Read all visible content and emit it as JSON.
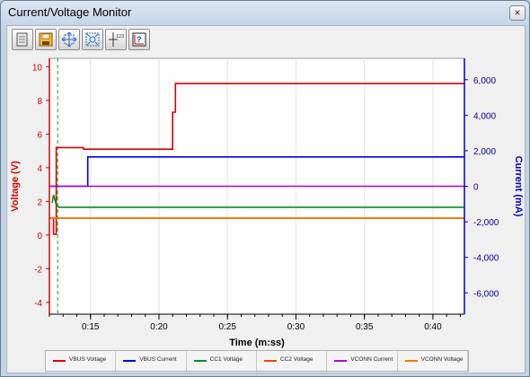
{
  "window": {
    "title": "Current/Voltage Monitor",
    "close_glyph": "×"
  },
  "toolbar": {
    "buttons": [
      {
        "name": "open-icon"
      },
      {
        "name": "save-icon"
      },
      {
        "name": "zoom-fit-icon"
      },
      {
        "name": "zoom-in-icon"
      },
      {
        "name": "cursor-measure-icon",
        "label": "123"
      },
      {
        "name": "chart-settings-icon"
      }
    ]
  },
  "chart_data": {
    "type": "line",
    "xlabel": "Time (m:ss)",
    "ylabel_left": "Voltage (V)",
    "ylabel_right": "Current (mA)",
    "x_ticks": [
      "0:15",
      "0:20",
      "0:25",
      "0:30",
      "0:35",
      "0:40"
    ],
    "x_tick_values": [
      15,
      20,
      25,
      30,
      35,
      40
    ],
    "xlim": [
      12,
      42.3
    ],
    "ylim_left": [
      -4.7,
      10.5
    ],
    "ylim_right": [
      -7200,
      7200
    ],
    "y_left_ticks": [
      "-4",
      "-2",
      "0",
      "2",
      "4",
      "6",
      "8",
      "10"
    ],
    "y_right_ticks": [
      "-6,000",
      "-4,000",
      "-2,000",
      "0",
      "2,000",
      "4,000",
      "6,000"
    ],
    "marker_x": 12.6,
    "series": [
      {
        "name": "VBUS Voltage",
        "color": "#d80000",
        "axis": "left",
        "points": [
          [
            12.2,
            1.0
          ],
          [
            12.3,
            1.0
          ],
          [
            12.3,
            0.05
          ],
          [
            12.5,
            0.05
          ],
          [
            12.5,
            5.2
          ],
          [
            14.5,
            5.2
          ],
          [
            14.5,
            5.1
          ],
          [
            21.0,
            5.1
          ],
          [
            21.0,
            7.3
          ],
          [
            21.2,
            7.3
          ],
          [
            21.2,
            9.0
          ],
          [
            42.3,
            9.0
          ]
        ]
      },
      {
        "name": "VBUS Current",
        "color": "#0000d8",
        "axis": "right",
        "points": [
          [
            12.0,
            0
          ],
          [
            14.8,
            0
          ],
          [
            14.8,
            1650
          ],
          [
            42.3,
            1650
          ]
        ]
      },
      {
        "name": "CC1 Voltage",
        "color": "#00901c",
        "axis": "left",
        "points": [
          [
            12.2,
            1.9
          ],
          [
            12.3,
            2.4
          ],
          [
            12.4,
            2.1
          ],
          [
            12.5,
            1.8
          ],
          [
            12.7,
            1.65
          ],
          [
            42.3,
            1.65
          ]
        ]
      },
      {
        "name": "CC2 Voltage",
        "color": "#e64a00",
        "axis": "left",
        "points": [
          [
            12.0,
            1.0
          ],
          [
            42.3,
            1.0
          ]
        ]
      },
      {
        "name": "VCONN Current",
        "color": "#b000d0",
        "axis": "right",
        "points": [
          [
            12.0,
            0
          ],
          [
            42.3,
            0
          ]
        ]
      },
      {
        "name": "VCONN Voltage",
        "color": "#f07800",
        "axis": "left",
        "points": [
          [
            12.0,
            1.0
          ],
          [
            42.3,
            1.0
          ]
        ]
      }
    ]
  }
}
